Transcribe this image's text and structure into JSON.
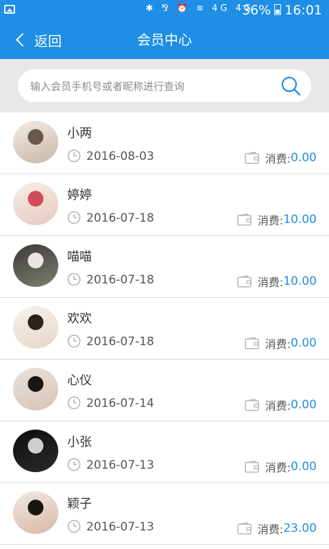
{
  "status_bar": {
    "icons": "✱ ⅋ ⏰ ≋ 4G 4G",
    "battery_pct": "36%",
    "time": "16:01"
  },
  "nav": {
    "back_label": "返回",
    "title": "会员中心"
  },
  "search": {
    "placeholder": "输入会员手机号或者昵称进行查询"
  },
  "members": [
    {
      "name": "小两",
      "date": "2016-08-03",
      "spend_label": "消费:",
      "spend": "0.00",
      "avatar_colors": [
        "#f3ece6",
        "#c9b8a6",
        "#6b5a4a"
      ]
    },
    {
      "name": "婷婷",
      "date": "2016-07-18",
      "spend_label": "消费:",
      "spend": "10.00",
      "avatar_colors": [
        "#f4efe6",
        "#e7c9c0",
        "#d24b5a"
      ]
    },
    {
      "name": "喵喵",
      "date": "2016-07-18",
      "spend_label": "消费:",
      "spend": "10.00",
      "avatar_colors": [
        "#3e3a36",
        "#7b7f72",
        "#e9e6e1"
      ]
    },
    {
      "name": "欢欢",
      "date": "2016-07-18",
      "spend_label": "消费:",
      "spend": "0.00",
      "avatar_colors": [
        "#f6f3ef",
        "#e5d6c6",
        "#2e231c"
      ]
    },
    {
      "name": "心仪",
      "date": "2016-07-14",
      "spend_label": "消费:",
      "spend": "0.00",
      "avatar_colors": [
        "#e8e3dd",
        "#d8c2b4",
        "#1a1714"
      ]
    },
    {
      "name": "小张",
      "date": "2016-07-13",
      "spend_label": "消费:",
      "spend": "0.00",
      "avatar_colors": [
        "#0d0d0d",
        "#2b2b2b",
        "#cfcfcf"
      ]
    },
    {
      "name": "颖子",
      "date": "2016-07-13",
      "spend_label": "消费:",
      "spend": "23.00",
      "avatar_colors": [
        "#efe8e1",
        "#d9b9a6",
        "#1b1510"
      ]
    }
  ],
  "colors": {
    "primary": "#1e8ee6",
    "amount": "#1e8ee6"
  }
}
